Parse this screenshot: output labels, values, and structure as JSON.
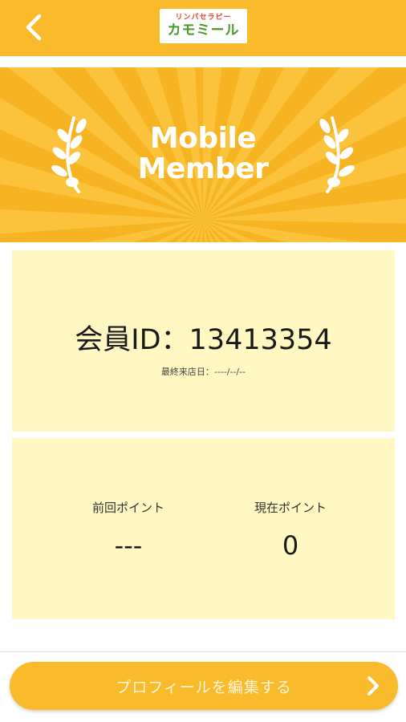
{
  "header": {
    "logo_top": "リンパセラピー",
    "logo_main": "カモミール"
  },
  "banner": {
    "title_line1": "Mobile",
    "title_line2": "Member"
  },
  "member": {
    "id_text": "会員ID：13413354",
    "last_visit": "最終来店日：----/--/--"
  },
  "points": {
    "previous_label": "前回ポイント",
    "previous_value": "---",
    "current_label": "現在ポイント",
    "current_value": "0"
  },
  "actions": {
    "edit_profile_label": "プロフィールを編集する"
  },
  "colors": {
    "brand": "#f9bb2c",
    "card_bg": "#fff8c2"
  },
  "icons": {
    "back": "chevron-left-icon",
    "edit_arrow": "chevron-right-icon",
    "laurel": "laurel-icon"
  }
}
